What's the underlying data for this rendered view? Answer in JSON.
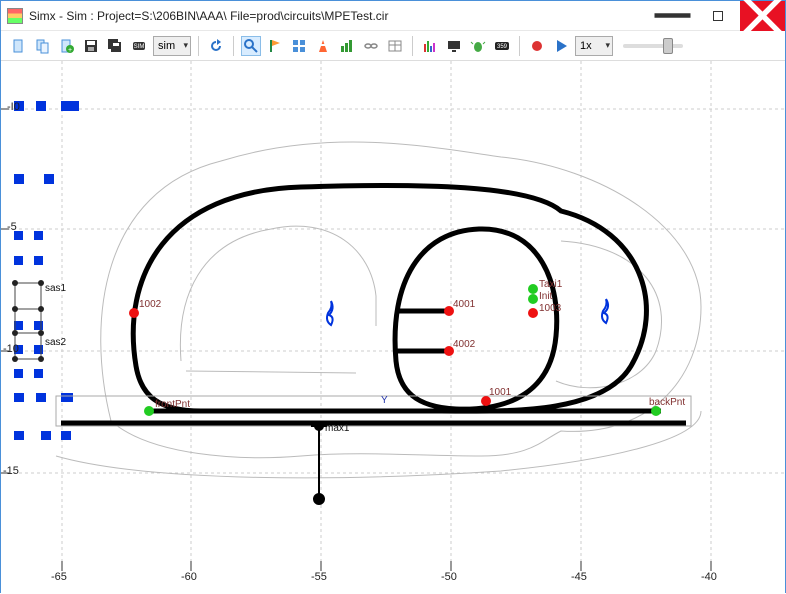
{
  "title": "Simx - Sim : Project=S:\\206BIN\\AAA\\  File=prod\\circuits\\MPETest.cir",
  "toolbar": {
    "simSelect": "sim",
    "speedSelect": "1x"
  },
  "axes": {
    "y": [
      "-I0",
      "-5",
      "-10",
      "-15"
    ],
    "x": [
      "-65",
      "-60",
      "-55",
      "-50",
      "-45",
      "-40"
    ]
  },
  "labels": {
    "sas1": "sas1",
    "sas2": "sas2",
    "p1002": "1002",
    "p4001": "4001",
    "p4002": "4002",
    "p1001": "1001",
    "p1003": "1003",
    "taxi1": "Taxi1",
    "init": "Init",
    "frontPnt": "frontPnt",
    "backPnt": "backPnt",
    "max1": "max1"
  }
}
